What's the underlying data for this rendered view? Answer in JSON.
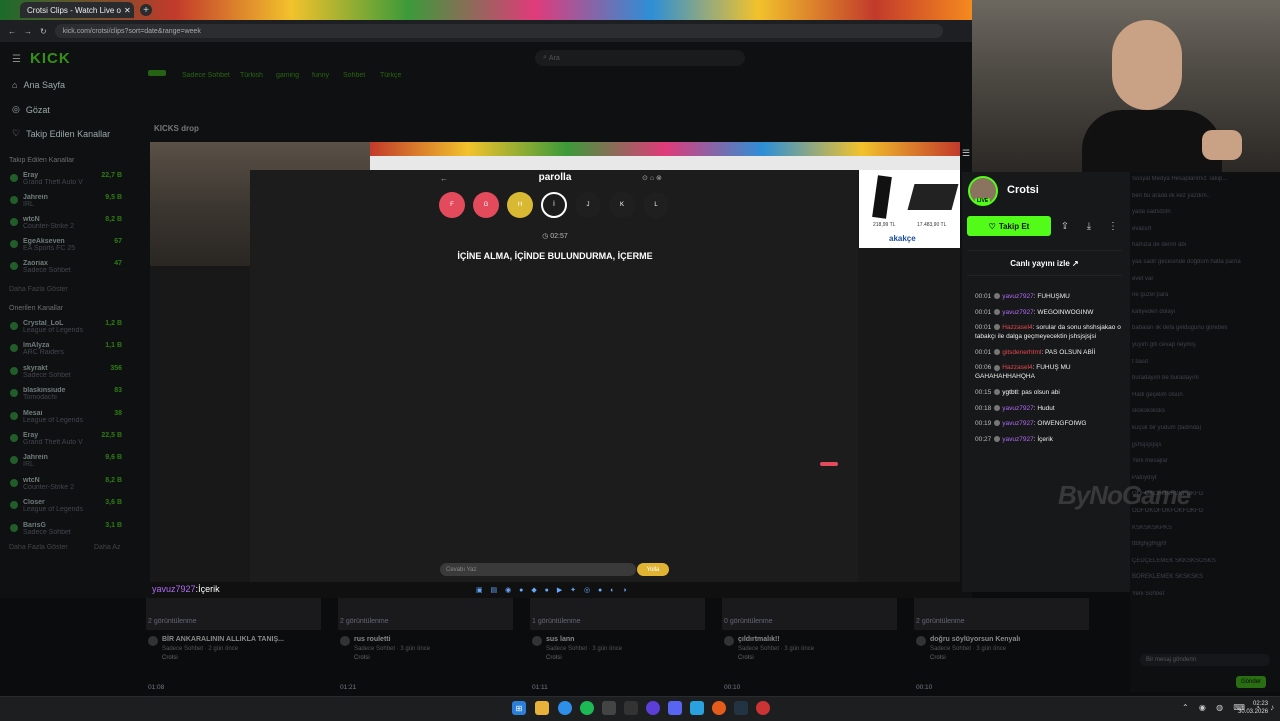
{
  "browser": {
    "tab_title": "Crotsi Clips - Watch Live o",
    "url": "kick.com/crotsi/clips?sort=date&range=week"
  },
  "site": {
    "logo": "KICK",
    "search_placeholder": "Ara",
    "nav": [
      {
        "label": "Ana Sayfa",
        "icon": "home-icon"
      },
      {
        "label": "Gözat",
        "icon": "compass-icon"
      },
      {
        "label": "Takip Edilen Kanallar",
        "icon": "heart-icon"
      }
    ],
    "followed_title": "Takip Edilen Kanallar",
    "followed": [
      {
        "name": "Eray",
        "game": "Grand Theft Auto V",
        "viewers": "22,7 B"
      },
      {
        "name": "Jahrein",
        "game": "IRL",
        "viewers": "9,5 B"
      },
      {
        "name": "wtcN",
        "game": "Counter-Strike 2",
        "viewers": "8,2 B"
      },
      {
        "name": "EgeAkseven",
        "game": "EA Sports FC 25",
        "viewers": "67"
      },
      {
        "name": "Zaoriax",
        "game": "Sadece Sohbet",
        "viewers": "47"
      }
    ],
    "followed_more": "Daha Fazla Göster",
    "recommended_title": "Önerilen Kanallar",
    "recommended": [
      {
        "name": "Crystal_LoL",
        "game": "League of Legends",
        "viewers": "1,2 B"
      },
      {
        "name": "lmAlyza",
        "game": "ARC Raiders",
        "viewers": "1,1 B"
      },
      {
        "name": "skyrakt",
        "game": "Sadece Sohbet",
        "viewers": "356"
      },
      {
        "name": "blaskinsiude",
        "game": "Tomodachi",
        "viewers": "83"
      },
      {
        "name": "Mesai",
        "game": "League of Legends",
        "viewers": "38"
      },
      {
        "name": "Eray",
        "game": "Grand Theft Auto V",
        "viewers": "22,5 B"
      },
      {
        "name": "Jahrein",
        "game": "IRL",
        "viewers": "9,6 B"
      },
      {
        "name": "wtcN",
        "game": "Counter-Strike 2",
        "viewers": "8,2 B"
      },
      {
        "name": "Closer",
        "game": "League of Legends",
        "viewers": "3,6 B"
      },
      {
        "name": "BarisG",
        "game": "Sadece Sohbet",
        "viewers": "3,1 B"
      }
    ],
    "recommended_more": "Daha Fazla Göster",
    "recommended_less": "Daha Az",
    "tags": [
      "Sadece Sohbet",
      "Türkish",
      "gaming",
      "funny",
      "Sohbet",
      "Türkçe"
    ],
    "section_title": "KICKS drop"
  },
  "game": {
    "title": "parolla",
    "letters": [
      {
        "letter": "F",
        "color": "#e34b5d"
      },
      {
        "letter": "G",
        "color": "#e34b5d"
      },
      {
        "letter": "H",
        "color": "#d9b834"
      },
      {
        "letter": "İ",
        "color": "#1c1c1c"
      },
      {
        "letter": "J",
        "color": "#1f1f1f"
      },
      {
        "letter": "K",
        "color": "#1f1f1f"
      },
      {
        "letter": "L",
        "color": "#1f1f1f"
      }
    ],
    "timer": "02:57",
    "clue": "İÇİNE ALMA, İÇİNDE BULUNDURMA, İÇERME",
    "answer_placeholder": "Cevabı Yaz",
    "answer_button": "Yolla",
    "ad_brand": "akakçe",
    "ad_price_1": "218,99 TL",
    "ad_price_2": "17.483,90 TL"
  },
  "overlay_chat": {
    "user": "yavuz7927",
    "sep": ":",
    "text": "İçerik"
  },
  "streamer": {
    "name": "Crotsi",
    "live_badge": "LIVE",
    "follow_label": "Takip Et",
    "watch_live": "Canlı yayını izle"
  },
  "chat": [
    {
      "time": "00:01",
      "user": "yavuz7927",
      "color": "#b06cf5",
      "text": "FUHUŞMU"
    },
    {
      "time": "00:01",
      "user": "yavuz7927",
      "color": "#b06cf5",
      "text": "WEGOINWOGINW"
    },
    {
      "time": "00:01",
      "user": "Hazzasel4",
      "color": "#e5484d",
      "text": "sorular da sonu shshsjakao o tabakçı ile dalga geçmeyecektin jshsjsjsjsi"
    },
    {
      "time": "00:01",
      "user": "gitsdenerhtml",
      "color": "#e5484d",
      "text": "PAS OLSUN ABİİ"
    },
    {
      "time": "00:06",
      "user": "Hazzasel4",
      "color": "#e5484d",
      "text": "FUHUŞ MU GAHAHAHHAHQHA"
    },
    {
      "time": "00:15",
      "user": "ygtbtl",
      "color": "#ffffff",
      "text": "pas olsun abi"
    },
    {
      "time": "00:18",
      "user": "yavuz7927",
      "color": "#b06cf5",
      "text": "Hudut"
    },
    {
      "time": "00:19",
      "user": "yavuz7927",
      "color": "#b06cf5",
      "text": "OIWENGFOIWG"
    },
    {
      "time": "00:27",
      "user": "yavuz7927",
      "color": "#b06cf5",
      "text": "İçerik"
    }
  ],
  "faded_chat": [
    "Sosyal Medya Hesaplarımız Takip...",
    "ben bu arada ilk kez yazdım..",
    "yada sadsdsfn",
    "evassrt",
    "hamiza de derim abi",
    "yaa sadir gecesinde doğdum hatta parna",
    "evet var",
    "ne güzel para",
    "kafiyeden dolayi",
    "babaları ilk defa geldugunu görebelı",
    "yuyım glfi cevap neymiş",
    "t basit",
    "buradayım be buradayım",
    "Hadi geçelim olsun",
    "sksksksksks",
    "küçük bir yudum (tadında)",
    "jjshsjsjsjsjs",
    "Yeni mesajlar",
    "Patlıydıyt",
    "ODFOKOFOKFOKFOKFG",
    "ODFOKOFOKFOKFOKFG",
    "KSKSKSKPKS",
    "ttbfghjgfhgjhf",
    "ÇEDÇELEMEK SKKSKSOSKS",
    "BÖREKLEMEK SKSKSKS",
    "Yeni Sohbet"
  ],
  "chat_send_placeholder": "Bir mesaj gönderin",
  "chat_send_button": "Gönder",
  "watermark": "ByNoGame",
  "clips": [
    {
      "views": "2 görüntülenme",
      "title": "BİR ANKARALININ ALLIKLA TANIŞ...",
      "sub": "Sadece Sohbet · 2 gün önce",
      "author": "Crotsi",
      "duration": "01:08"
    },
    {
      "views": "2 görüntülenme",
      "title": "rus rouletti",
      "sub": "Sadece Sohbet · 3 gün önce",
      "author": "Crotsi",
      "duration": "01:21"
    },
    {
      "views": "1 görüntülenme",
      "title": "sus lann",
      "sub": "Sadece Sohbet · 3 gün önce",
      "author": "Crotsi",
      "duration": "01:11"
    },
    {
      "views": "0 görüntülenme",
      "title": "çıldırtmalık!!",
      "sub": "Sadece Sohbet · 3 gün önce",
      "author": "Crotsi",
      "duration": "00:10"
    },
    {
      "views": "2 görüntülenme",
      "title": "doğru söylüyorsun Kenyalı",
      "sub": "Sadece Sohbet · 3 gün önce",
      "author": "Crotsi",
      "duration": "00:10"
    }
  ],
  "taskbar": {
    "time": "02:23",
    "date": "30.03.2026"
  },
  "colors": {
    "kick_green": "#53fc18",
    "bg": "#0b0c0d"
  }
}
